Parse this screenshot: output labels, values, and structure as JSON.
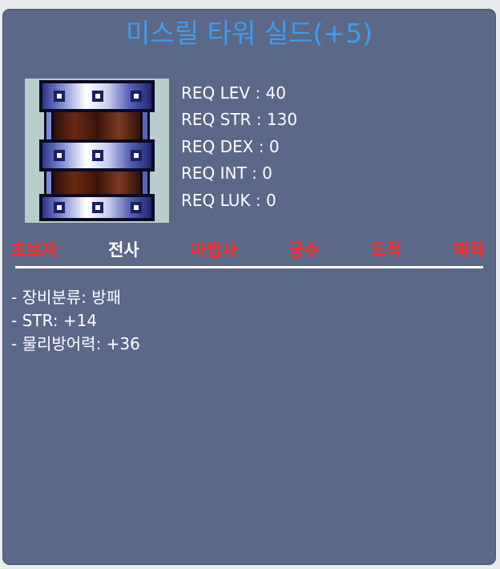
{
  "item": {
    "name": "미스릴 타워 실드(+5)",
    "icon": "mithril-tower-shield-icon",
    "name_color": "#3d9df2"
  },
  "requirements": [
    {
      "label": "REQ LEV : 40"
    },
    {
      "label": "REQ STR : 130"
    },
    {
      "label": "REQ DEX : 0"
    },
    {
      "label": "REQ INT : 0"
    },
    {
      "label": "REQ LUK : 0"
    }
  ],
  "jobs": [
    {
      "label": "초보자",
      "allowed": false
    },
    {
      "label": "전사",
      "allowed": true
    },
    {
      "label": "마법사",
      "allowed": false
    },
    {
      "label": "궁수",
      "allowed": false
    },
    {
      "label": "도적",
      "allowed": false
    },
    {
      "label": "해적",
      "allowed": false
    }
  ],
  "colors": {
    "job_allowed": "#ffffff",
    "job_disallowed": "#ff2a2a",
    "panel_bg": "#5b6887"
  },
  "stats": [
    {
      "text": "- 장비분류: 방패"
    },
    {
      "text": "- STR: +14"
    },
    {
      "text": "- 물리방어력: +36"
    }
  ]
}
